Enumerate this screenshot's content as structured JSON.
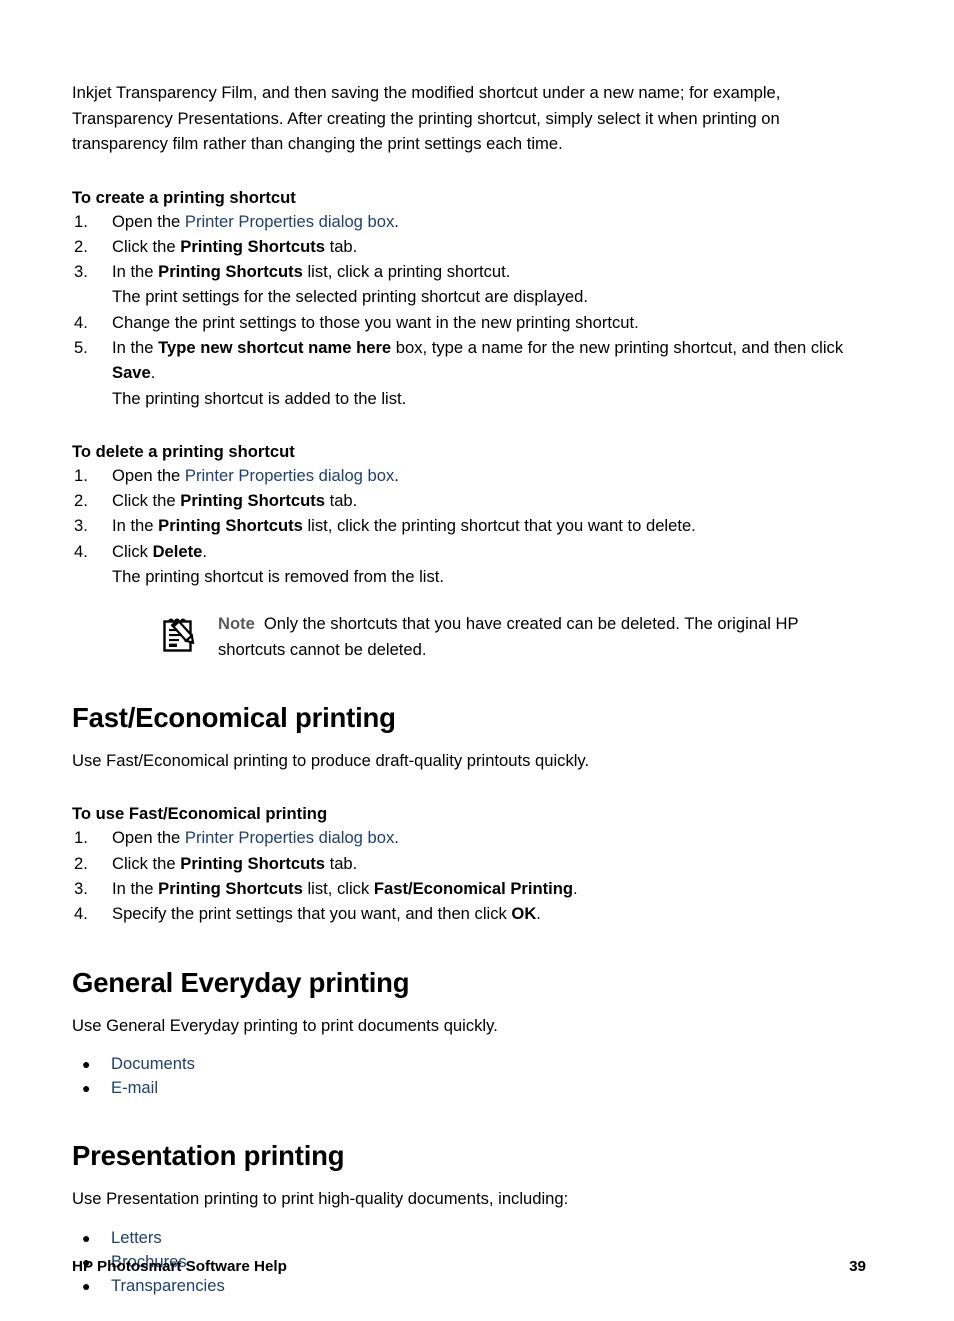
{
  "document": {
    "footer_title": "HP Photosmart Software Help",
    "page_number": "39",
    "link_color": "#1c4071",
    "note_label_color": "#5a5a5a"
  },
  "intro": {
    "paragraph": "Inkjet Transparency Film, and then saving the modified shortcut under a new name; for example, Transparency Presentations. After creating the printing shortcut, simply select it when printing on transparency film rather than changing the print settings each time."
  },
  "create_shortcut": {
    "heading": "To create a printing shortcut",
    "steps": [
      {
        "num": "1.",
        "parts": [
          {
            "t": "plain",
            "text": "Open the "
          },
          {
            "t": "link",
            "text": "Printer Properties dialog box"
          },
          {
            "t": "plain",
            "text": "."
          }
        ]
      },
      {
        "num": "2.",
        "parts": [
          {
            "t": "plain",
            "text": "Click the "
          },
          {
            "t": "bold",
            "text": "Printing Shortcuts"
          },
          {
            "t": "plain",
            "text": " tab."
          }
        ]
      },
      {
        "num": "3.",
        "parts": [
          {
            "t": "plain",
            "text": "In the "
          },
          {
            "t": "bold",
            "text": "Printing Shortcuts"
          },
          {
            "t": "plain",
            "text": " list, click a printing shortcut."
          }
        ],
        "substeps": [
          "The print settings for the selected printing shortcut are displayed."
        ]
      },
      {
        "num": "4.",
        "parts": [
          {
            "t": "plain",
            "text": "Change the print settings to those you want in the new printing shortcut."
          }
        ]
      },
      {
        "num": "5.",
        "parts": [
          {
            "t": "plain",
            "text": "In the "
          },
          {
            "t": "bold",
            "text": "Type new shortcut name here"
          },
          {
            "t": "plain",
            "text": " box, type a name for the new printing shortcut, and then click "
          },
          {
            "t": "bold",
            "text": "Save"
          },
          {
            "t": "plain",
            "text": "."
          }
        ],
        "substeps": [
          "The printing shortcut is added to the list."
        ]
      }
    ]
  },
  "delete_shortcut": {
    "heading": "To delete a printing shortcut",
    "steps": [
      {
        "num": "1.",
        "parts": [
          {
            "t": "plain",
            "text": "Open the "
          },
          {
            "t": "link",
            "text": "Printer Properties dialog box"
          },
          {
            "t": "plain",
            "text": "."
          }
        ]
      },
      {
        "num": "2.",
        "parts": [
          {
            "t": "plain",
            "text": "Click the "
          },
          {
            "t": "bold",
            "text": "Printing Shortcuts"
          },
          {
            "t": "plain",
            "text": " tab."
          }
        ]
      },
      {
        "num": "3.",
        "parts": [
          {
            "t": "plain",
            "text": "In the "
          },
          {
            "t": "bold",
            "text": "Printing Shortcuts"
          },
          {
            "t": "plain",
            "text": " list, click the printing shortcut that you want to delete."
          }
        ]
      },
      {
        "num": "4.",
        "parts": [
          {
            "t": "plain",
            "text": "Click "
          },
          {
            "t": "bold",
            "text": "Delete"
          },
          {
            "t": "plain",
            "text": "."
          }
        ],
        "substeps": [
          "The printing shortcut is removed from the list."
        ]
      }
    ]
  },
  "note": {
    "icon": "note-pad-pencil-icon",
    "label": "Note",
    "text": "Only the shortcuts that you have created can be deleted. The original HP shortcuts cannot be deleted."
  },
  "fast_economical": {
    "heading": "Fast/Economical printing",
    "intro": "Use Fast/Economical printing to produce draft-quality printouts quickly.",
    "subheading": "To use Fast/Economical printing",
    "steps": [
      {
        "num": "1.",
        "parts": [
          {
            "t": "plain",
            "text": "Open the "
          },
          {
            "t": "link",
            "text": "Printer Properties dialog box"
          },
          {
            "t": "plain",
            "text": "."
          }
        ]
      },
      {
        "num": "2.",
        "parts": [
          {
            "t": "plain",
            "text": "Click the "
          },
          {
            "t": "bold",
            "text": "Printing Shortcuts"
          },
          {
            "t": "plain",
            "text": " tab."
          }
        ]
      },
      {
        "num": "3.",
        "parts": [
          {
            "t": "plain",
            "text": "In the "
          },
          {
            "t": "bold",
            "text": "Printing Shortcuts"
          },
          {
            "t": "plain",
            "text": " list, click "
          },
          {
            "t": "bold",
            "text": "Fast/Economical Printing"
          },
          {
            "t": "plain",
            "text": "."
          }
        ]
      },
      {
        "num": "4.",
        "parts": [
          {
            "t": "plain",
            "text": "Specify the print settings that you want, and then click "
          },
          {
            "t": "bold",
            "text": "OK"
          },
          {
            "t": "plain",
            "text": "."
          }
        ]
      }
    ]
  },
  "general_everyday": {
    "heading": "General Everyday printing",
    "intro": "Use General Everyday printing to print documents quickly.",
    "links": [
      "Documents",
      "E-mail"
    ]
  },
  "presentation": {
    "heading": "Presentation printing",
    "intro": "Use Presentation printing to print high-quality documents, including:",
    "links": [
      "Letters",
      "Brochures",
      "Transparencies"
    ]
  }
}
